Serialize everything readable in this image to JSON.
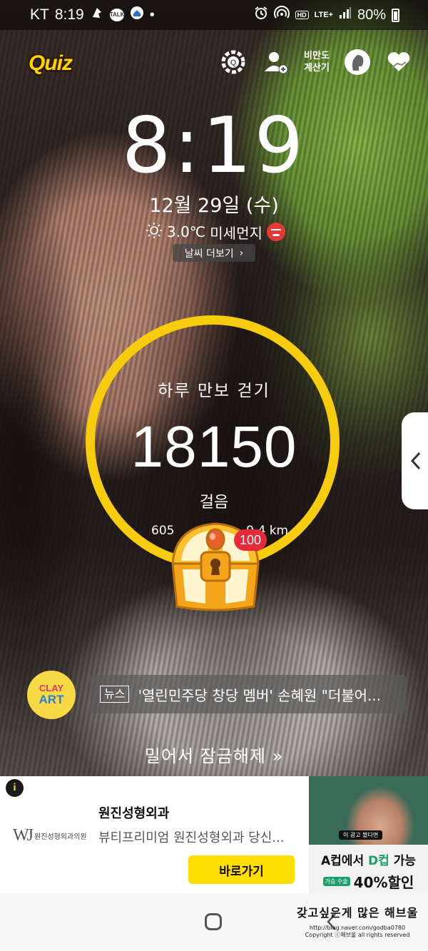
{
  "status_bar": {
    "carrier": "KT",
    "time": "8:19",
    "notif_talk": "TALK",
    "dot": "•",
    "hd": "HD",
    "lte": "LTE+",
    "battery": "80%"
  },
  "toolbar": {
    "quiz_logo": "Quiz",
    "bmi_line1": "비만도",
    "bmi_line2": "계산기",
    "icons": [
      "quiz-settings-icon",
      "add-user-icon",
      "bmi-calculator",
      "profile-head-icon",
      "heart-hand-icon"
    ]
  },
  "lock": {
    "clock": "8:19",
    "date": "12월 29일 (수)",
    "temperature": "3.0℃",
    "dust_label": "미세먼지",
    "weather_more": "날씨 더보기",
    "chevron": "›"
  },
  "walk": {
    "title": "하루 만보 걷기",
    "steps": "18150",
    "unit": "걸음",
    "extra_left": "605",
    "extra_right": "9.4 km",
    "reward_badge": "100",
    "ring_color": "#f7cc0e"
  },
  "news": {
    "avatar_line1": "CLAY",
    "avatar_line2": "ART",
    "tag": "뉴스",
    "headline": "'열린민주당 창당 멤버' 손혜원 \"더불어..."
  },
  "unlock": {
    "text": "밀어서 잠금해제",
    "arrows": "»"
  },
  "ad": {
    "info": "i",
    "logo_mark": "WJ",
    "logo_name": "원진성형외과의원",
    "title": "원진성형외과",
    "description": "뷰티프리미엄 원진성형외과 당신...",
    "cta": "바로가기",
    "image_caption": "이 광고 봤다면",
    "headline_part1": "A컵에서 ",
    "headline_accent": "D컵",
    "headline_part2": " 가능",
    "chip": "가슴 수술",
    "sale": "40%할인",
    "accent_color": "#1d9f6a",
    "cta_color": "#fedd00"
  },
  "watermark": {
    "line1": "갖고싶은게 많은 해브울",
    "line2": "http://blog.naver.com/godba0780",
    "line3": "Copyright ⓒ해브울 all rights reserved"
  }
}
